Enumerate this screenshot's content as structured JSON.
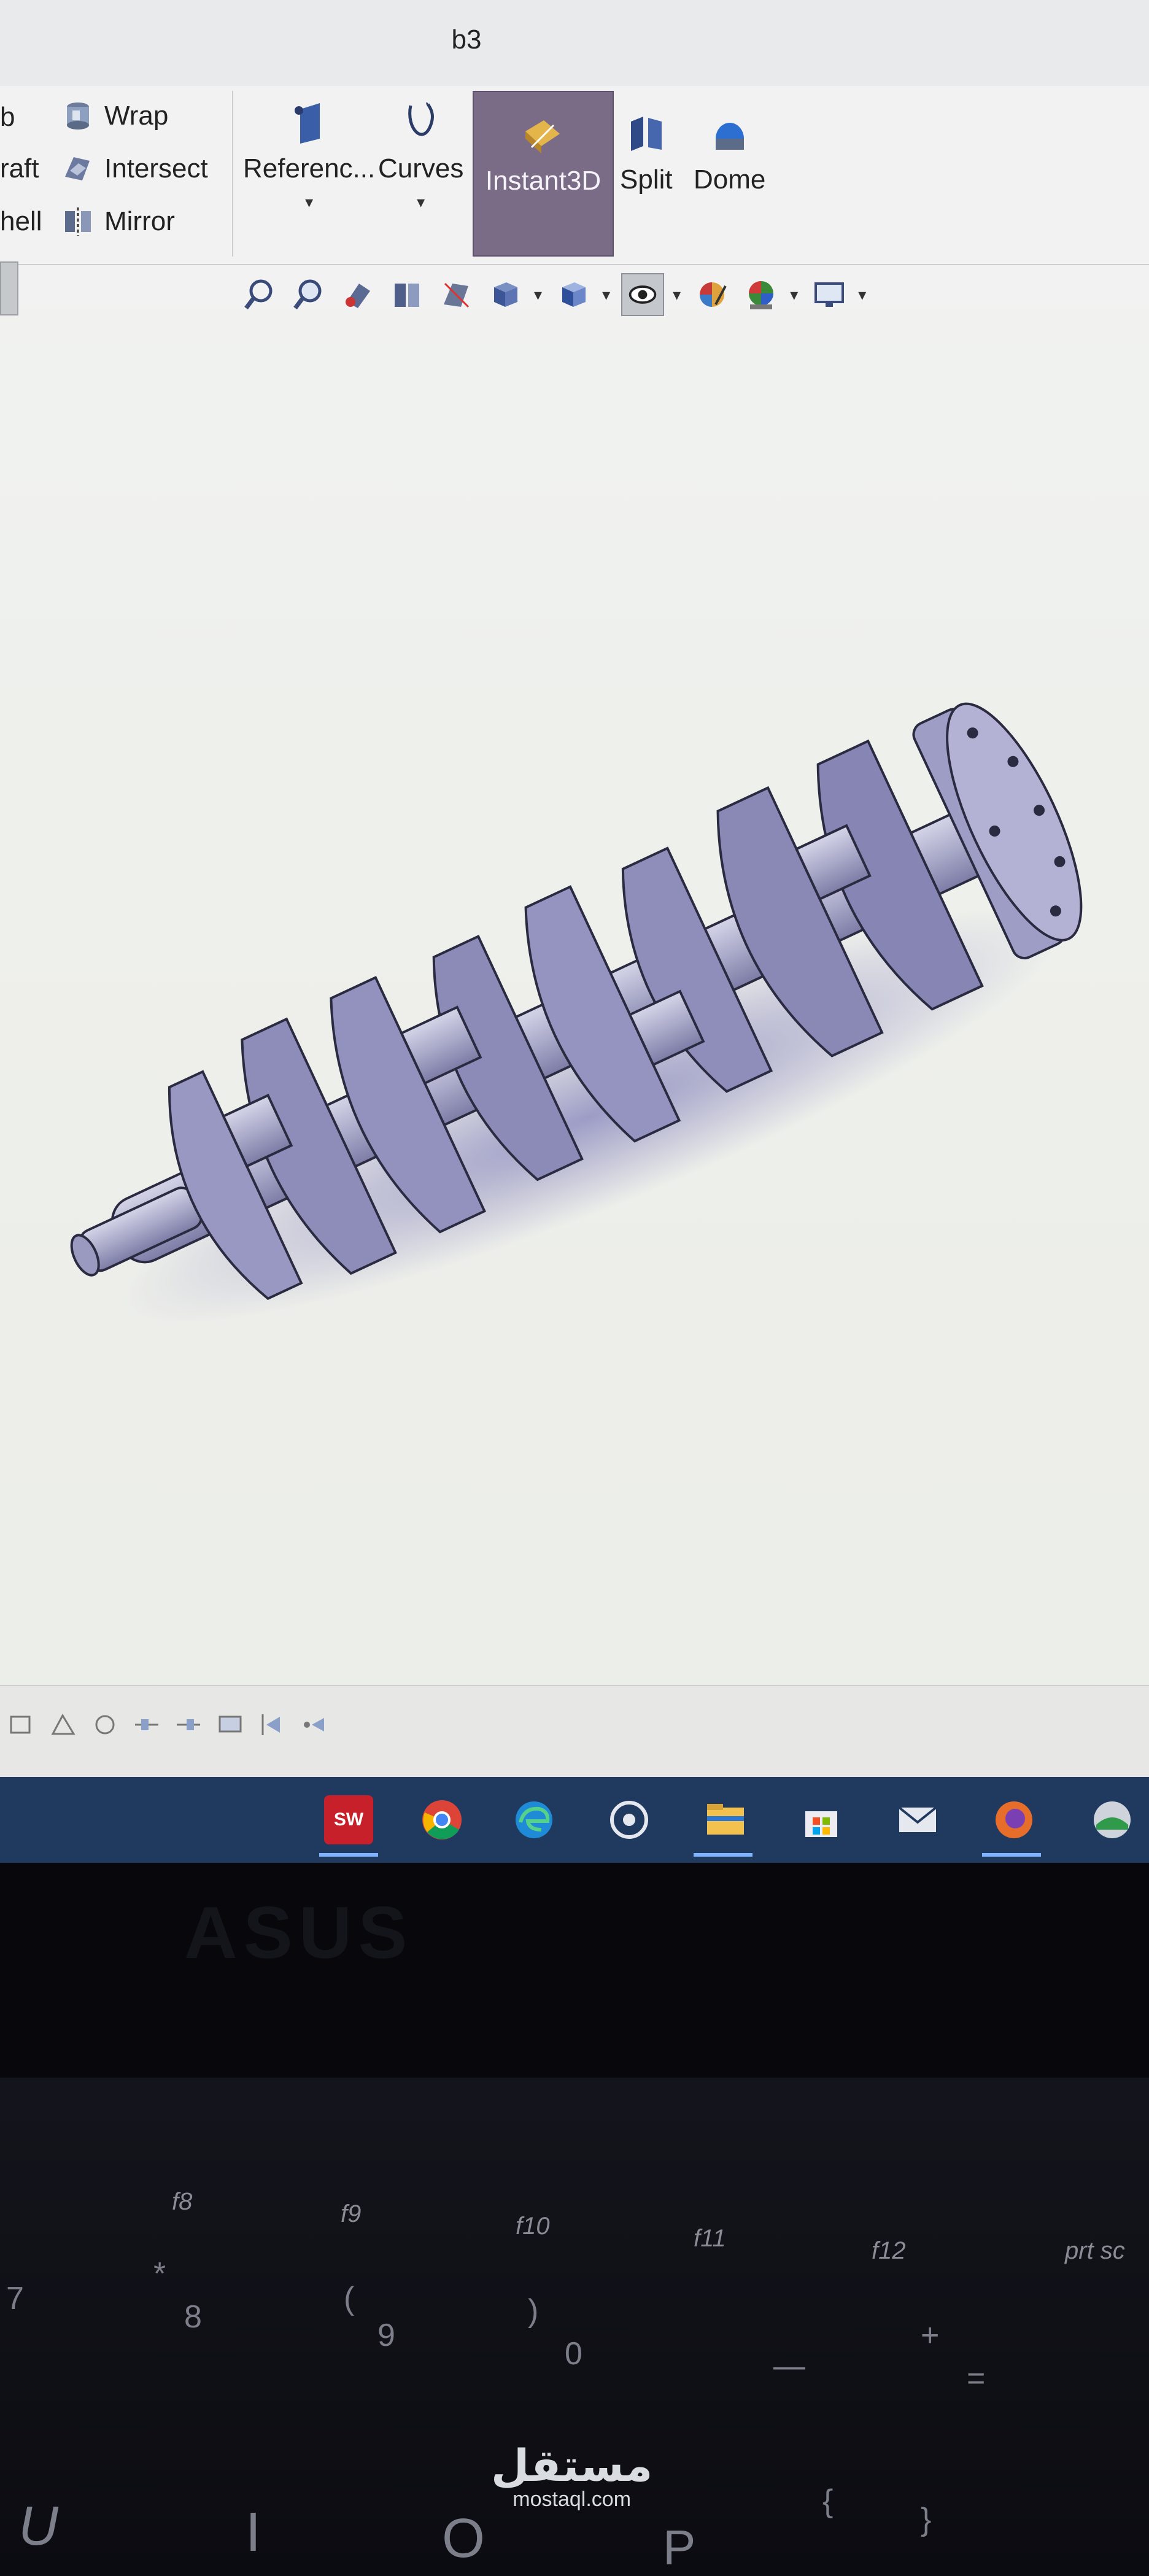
{
  "window": {
    "title": "b3"
  },
  "ribbon": {
    "left_col": [
      "b",
      "raft",
      "hell"
    ],
    "mid_col": [
      "Wrap",
      "Intersect",
      "Mirror"
    ],
    "big_buttons": [
      "Referenc...",
      "Curves",
      "Instant3D",
      "Split",
      "Dome"
    ]
  },
  "view_toolbar": {
    "icons": [
      "zoom-to-fit-icon",
      "zoom-to-area-icon",
      "previous-view-icon",
      "section-view-icon",
      "dynamic-annotation-icon",
      "view-orientation-icon",
      "display-style-icon",
      "hide-show-items-icon",
      "edit-appearance-icon",
      "apply-scene-icon",
      "view-settings-icon"
    ]
  },
  "taskbar": {
    "apps": [
      {
        "name": "SOLIDWORKS",
        "label": "SW"
      },
      {
        "name": "Chrome",
        "label": ""
      },
      {
        "name": "Edge",
        "label": ""
      },
      {
        "name": "Groove",
        "label": ""
      },
      {
        "name": "File Explorer",
        "label": ""
      },
      {
        "name": "Store",
        "label": ""
      },
      {
        "name": "Mail",
        "label": ""
      },
      {
        "name": "Firefox",
        "label": ""
      },
      {
        "name": "Other",
        "label": ""
      }
    ],
    "colors": {
      "taskbar_bg": "#203a5f",
      "active_underline": "#7eb3ff"
    }
  },
  "laptop": {
    "brand": "ASUS",
    "fkeys": [
      "f8",
      "f9",
      "f10",
      "f11",
      "f12",
      "prt sc"
    ],
    "keys": [
      "7",
      "*",
      "8",
      "(",
      "9",
      ")",
      "0",
      "—",
      "+",
      "=",
      "U",
      "I",
      "O",
      "P",
      "{",
      "}"
    ]
  },
  "watermark": {
    "arabic": "مستقل",
    "latin": "mostaql.com"
  },
  "colors": {
    "instant3d_active": "#7a6b87",
    "part_color": "#a9a9c9",
    "part_shadow": "#5b58a8"
  }
}
